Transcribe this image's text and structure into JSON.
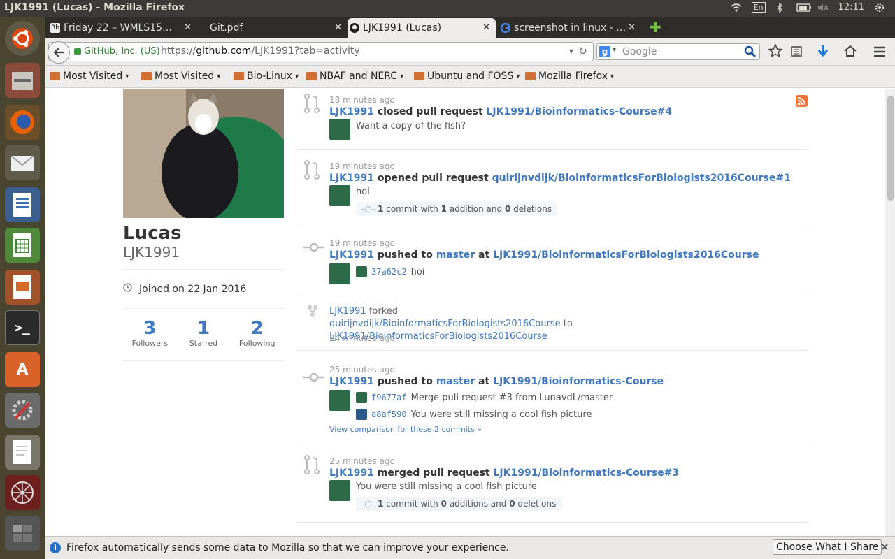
{
  "window_title": "LJK1991 (Lucas) - Mozilla Firefox",
  "tray": {
    "keyboard": "En",
    "time": "12:11"
  },
  "tabs": [
    {
      "label": "Friday 22 – WMLS15…",
      "close": "✕"
    },
    {
      "label": "Git.pdf",
      "close": "✕"
    },
    {
      "label": "LJK1991 (Lucas)",
      "close": "✕"
    },
    {
      "label": "screenshot in linux - …",
      "close": "✕"
    }
  ],
  "nav": {
    "identity": "GitHub, Inc. (US)",
    "url_prefix": "https://",
    "url_host": "github.com",
    "url_path": "/LJK1991?tab=activity",
    "search_placeholder": "Google"
  },
  "bookmarks": [
    "Most Visited",
    "Most Visited",
    "Bio-Linux",
    "NBAF and NERC",
    "Ubuntu and FOSS",
    "Mozilla Firefox"
  ],
  "profile": {
    "name": "Lucas",
    "username": "LJK1991",
    "joined": "Joined on 22 Jan 2016",
    "stats": [
      {
        "count": "3",
        "label": "Followers"
      },
      {
        "count": "1",
        "label": "Starred"
      },
      {
        "count": "2",
        "label": "Following"
      }
    ]
  },
  "events": [
    {
      "time": "18 minutes ago",
      "user": "LJK1991",
      "action": "closed pull request",
      "target": "LJK1991/Bioinformatics-Course#4",
      "body": "Want a copy of the fish?"
    },
    {
      "time": "19 minutes ago",
      "user": "LJK1991",
      "action": "opened pull request",
      "target": "quirijnvdijk/BioinformaticsForBiologists2016Course#1",
      "body": "hoi",
      "commit_n": "1",
      "commit_mid": "commit with",
      "adds": "1",
      "adds_label": "addition and",
      "dels": "0",
      "dels_label": "deletions"
    },
    {
      "time": "19 minutes ago",
      "user": "LJK1991",
      "action": "pushed to",
      "branch": "master",
      "at": "at",
      "target": "LJK1991/BioinformaticsForBiologists2016Course",
      "commits": [
        {
          "sha": "37a62c2",
          "msg": "hoi"
        }
      ]
    },
    {
      "time": "24 minutes ago",
      "user": "LJK1991",
      "action": "forked",
      "target": "quirijnvdijk/BioinformaticsForBiologists2016Course",
      "to": "to",
      "dest": "LJK1991/BioinformaticsForBiologists2016Course"
    },
    {
      "time": "25 minutes ago",
      "user": "LJK1991",
      "action": "pushed to",
      "branch": "master",
      "at": "at",
      "target": "LJK1991/Bioinformatics-Course",
      "commits": [
        {
          "sha": "f9677af",
          "msg": "Merge pull request #3 from LunavdL/master"
        },
        {
          "sha": "a8af590",
          "msg": "You were still missing a cool fish picture"
        }
      ],
      "compare": "View comparison for these 2 commits »"
    },
    {
      "time": "25 minutes ago",
      "user": "LJK1991",
      "action": "merged pull request",
      "target": "LJK1991/Bioinformatics-Course#3",
      "body": "You were still missing a cool fish picture",
      "commit_n": "1",
      "commit_mid": "commit with",
      "adds": "0",
      "adds_label": "additions and",
      "dels": "0",
      "dels_label": "deletions"
    }
  ],
  "notification": {
    "text": "Firefox automatically sends some data to Mozilla so that we can improve your experience.",
    "button": "Choose What I Share"
  },
  "colors": {
    "link": "#4078c0",
    "topbar": "#3c3b37",
    "launcher": "#4a4530"
  }
}
